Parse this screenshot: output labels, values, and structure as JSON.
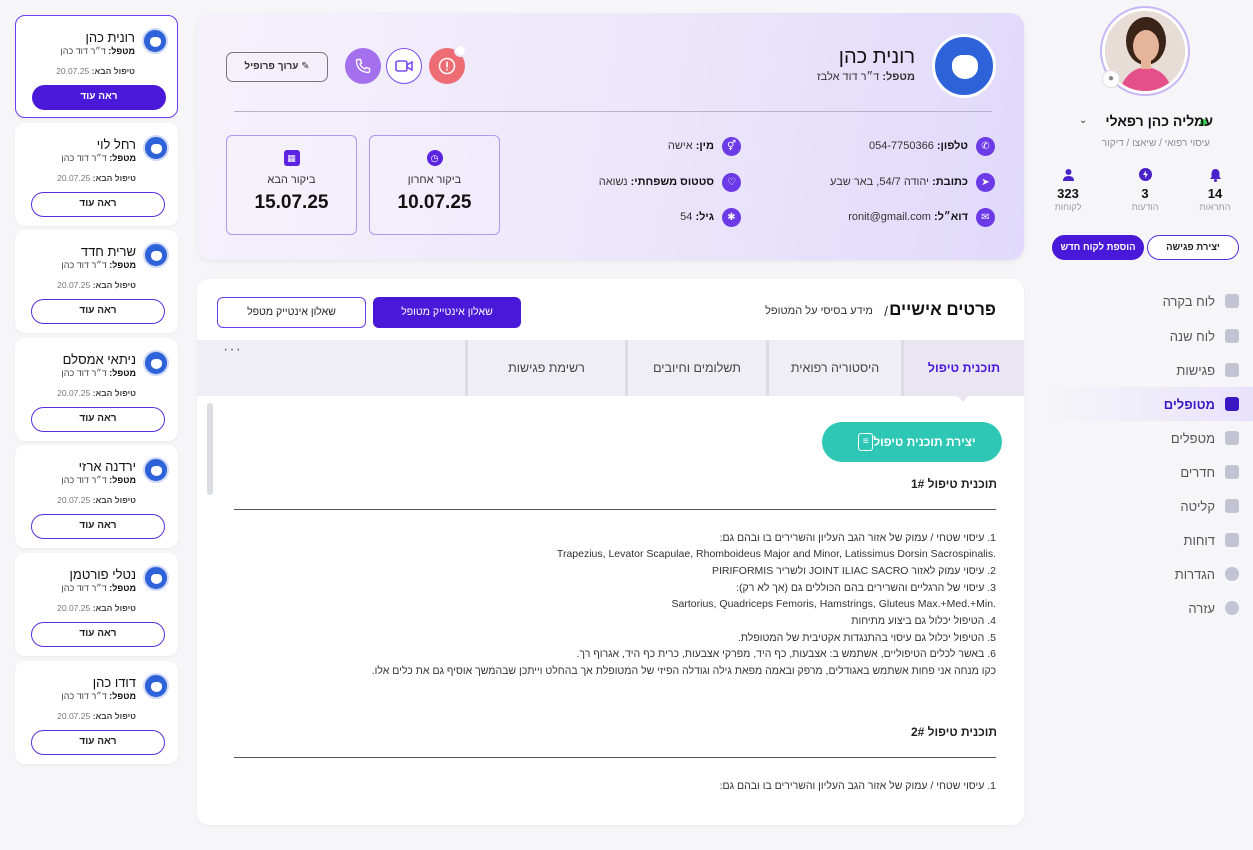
{
  "sidebar": {
    "user": {
      "name": "עמליה כהן רפאלי",
      "roles": "עיסוי רפואי / שיאצו / דיקור",
      "chevron": "⌄"
    },
    "stats": [
      {
        "icon": "bell-icon",
        "glyph": "🔔",
        "value": "14",
        "label": "התראות"
      },
      {
        "icon": "bolt-icon",
        "glyph": "⚡",
        "value": "3",
        "label": "הודעות"
      },
      {
        "icon": "person-icon",
        "glyph": "👤",
        "value": "323",
        "label": "לקוחות"
      }
    ],
    "buttons": {
      "new_meeting": "יצירת פגישה",
      "add_client": "הוספת לקוח חדש"
    },
    "nav": [
      {
        "label": "לוח בקרה",
        "icon": "dashboard-icon"
      },
      {
        "label": "לוח שנה",
        "icon": "calendar-icon"
      },
      {
        "label": "פגישות",
        "icon": "meetings-icon"
      },
      {
        "label": "מטופלים",
        "icon": "patients-icon",
        "active": true
      },
      {
        "label": "מטפלים",
        "icon": "therapists-icon"
      },
      {
        "label": "חדרים",
        "icon": "rooms-icon"
      },
      {
        "label": "קליטה",
        "icon": "intake-icon"
      },
      {
        "label": "דוחות",
        "icon": "reports-icon"
      },
      {
        "label": "הגדרות",
        "icon": "settings-icon"
      },
      {
        "label": "עזרה",
        "icon": "help-icon"
      }
    ]
  },
  "patients": [
    {
      "name": "רונית כהן",
      "doc_label": "מטפל:",
      "doc": "ד״ר דוד כהן",
      "next_label": "טיפול הבא:",
      "next": "20.07.25",
      "button": "ראה עוד"
    },
    {
      "name": "רחל לוי",
      "doc_label": "מטפל:",
      "doc": "ד״ר דוד כהן",
      "next_label": "טיפול הבא:",
      "next": "20.07.25",
      "button": "ראה עוד"
    },
    {
      "name": "שרית חדד",
      "doc_label": "מטפל:",
      "doc": "ד״ר דוד כהן",
      "next_label": "טיפול הבא:",
      "next": "20.07.25",
      "button": "ראה עוד"
    },
    {
      "name": "ניתאי אמסלם",
      "doc_label": "מטפל:",
      "doc": "ד״ר דוד כהן",
      "next_label": "טיפול הבא:",
      "next": "20.07.25",
      "button": "ראה עוד"
    },
    {
      "name": "ירדנה ארזי",
      "doc_label": "מטפל:",
      "doc": "ד״ר דוד כהן",
      "next_label": "טיפול הבא:",
      "next": "20.07.25",
      "button": "ראה עוד"
    },
    {
      "name": "נטלי פורטמן",
      "doc_label": "מטפל:",
      "doc": "ד״ר דוד כהן",
      "next_label": "טיפול הבא:",
      "next": "20.07.25",
      "button": "ראה עוד"
    },
    {
      "name": "דודו כהן",
      "doc_label": "מטפל:",
      "doc": "ד״ר דוד כהן",
      "next_label": "טיפול הבא:",
      "next": "20.07.25",
      "button": "ראה עוד"
    }
  ],
  "header": {
    "name": "רונית כהן",
    "doc_label": "מטפל:",
    "doc": "ד״ר דוד אלבז",
    "edit_button": "ערוך פרופיל",
    "info": {
      "phone_label": "טלפון:",
      "phone": "054-7750366",
      "address_label": "כתובת:",
      "address": "יהודה 54/7, באר שבע",
      "email_label": "דוא״ל:",
      "email": "ronit@gmail.com",
      "gender_label": "מין:",
      "gender": "אישה",
      "marital_label": "סטטוס משפחתי:",
      "marital": "נשואה",
      "age_label": "גיל:",
      "age": "54"
    },
    "last_visit_label": "ביקור אחרון",
    "last_visit": "10.07.25",
    "next_visit_label": "ביקור הבא",
    "next_visit": "15.07.25"
  },
  "main": {
    "title": "פרטים אישיים",
    "separator": "/",
    "subtitle": "מידע בסיסי על המטופל",
    "q_patient": "שאלון אינטייק מטופל",
    "q_therapist": "שאלון אינטייק מטפל",
    "tabs": [
      "תוכנית טיפול",
      "היסטוריה רפואית",
      "תשלומים וחיובים",
      "רשימת פגישות"
    ],
    "more": "···",
    "create_plan": "יצירת תוכנית טיפול",
    "plan1_title": "תוכנית טיפול  1#",
    "plan1_lines": [
      "1.  עיסוי שטחי / עמוק של אזור הגב העליון והשרירים בו ובהם גם:",
      "Trapezius, Levator Scapulae, Rhomboideus Major and Minor, Latissimus Dorsin Sacrospinalis.",
      "2.  עיסוי עמוק לאזור JOINT ILIAC SACRO ולשריר PIRIFORMIS",
      "3.  עיסוי של הרגליים והשרירים בהם הכוללים גם (אך לא רק):",
      "Sartorius, Quadriceps Femoris, Hamstrings, Gluteus Max.+Med.+Min.",
      "4.  הטיפול יכלול גם ביצוע מתיחות",
      "5.  הטיפול יכלול גם עיסוי בהתנגדות אקטיבית של המטופלת.",
      "6.  באשר לכלים הטיפוליים, אשתמש ב: אצבעות, כף היד, מפרקי אצבעות, כרית כף היד, אגרוף רך.",
      "כקו מנחה אני פחות אשתמש באגודלים, מרפק ובאמה מפאת גילה וגודלה הפיזי של המטופלת אך בהחלט וייתכן שבהמשך אוסיף גם את כלים אלו."
    ],
    "plan2_title": "תוכנית טיפול  2#",
    "plan2_lines": [
      "1.  עיסוי שטחי / עמוק של אזור הגב העליון והשרירים בו ובהם גם:"
    ]
  }
}
